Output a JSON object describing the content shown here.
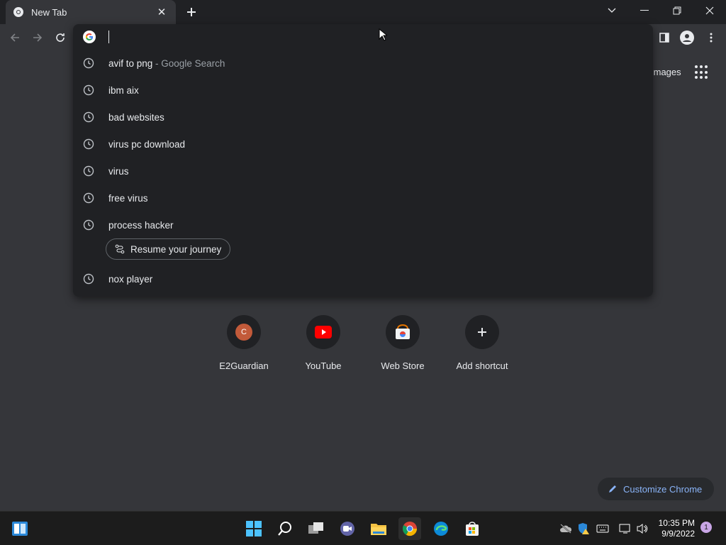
{
  "browser": {
    "tab": {
      "title": "New Tab"
    },
    "omnibox": {
      "suggestions": [
        {
          "text": "avif to png",
          "extra": " - Google Search"
        },
        {
          "text": "ibm aix",
          "extra": ""
        },
        {
          "text": "bad websites",
          "extra": ""
        },
        {
          "text": "virus pc download",
          "extra": ""
        },
        {
          "text": "virus",
          "extra": ""
        },
        {
          "text": "free virus",
          "extra": ""
        },
        {
          "text": "process hacker",
          "extra": ""
        },
        {
          "text": "nox player",
          "extra": ""
        }
      ],
      "journey_label": "Resume your journey"
    }
  },
  "page": {
    "images_link": "Images",
    "shortcuts": [
      {
        "label": "E2Guardian",
        "letter": "C"
      },
      {
        "label": "YouTube"
      },
      {
        "label": "Web Store"
      },
      {
        "label": "Add shortcut"
      }
    ],
    "customize_label": "Customize Chrome"
  },
  "taskbar": {
    "time": "10:35 PM",
    "date": "9/9/2022",
    "notification_count": "1"
  },
  "colors": {
    "page_bg": "#35363a",
    "omnibox_bg": "#202124",
    "accent": "#8ab4f8",
    "youtube_red": "#ff0000",
    "e2guardian_orange": "#c25a3a"
  }
}
